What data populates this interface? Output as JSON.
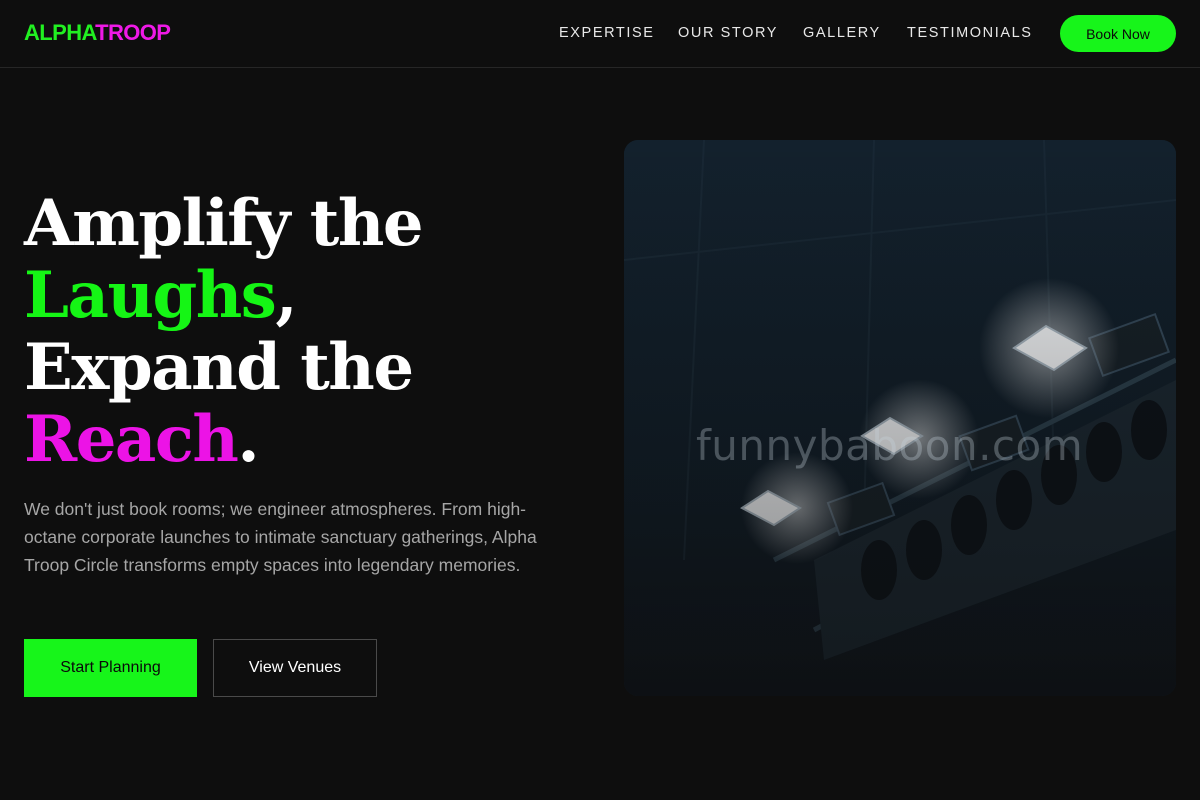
{
  "brand": {
    "part1": "ALPHA",
    "part2": "TROOP",
    "color1": "#21f021",
    "color2": "#ef19e7"
  },
  "nav": {
    "links": [
      "EXPERTISE",
      "OUR STORY",
      "GALLERY",
      "TESTIMONIALS"
    ],
    "cta": "Book Now"
  },
  "hero": {
    "title": {
      "line1": "Amplify the",
      "line2_word": "Laughs",
      "line2_punct": ",",
      "line3": "Expand the",
      "line4_word": "Reach",
      "line4_punct": "."
    },
    "description": "We don't just book rooms; we engineer atmospheres. From high-octane corporate launches to intimate sanctuary gatherings, Alpha Troop Circle transforms empty spaces into legendary memories.",
    "primary_button": "Start Planning",
    "secondary_button": "View Venues",
    "image_watermark": "funnybaboon.com"
  },
  "colors": {
    "accent_green": "#17f51a",
    "accent_magenta": "#ec13e6",
    "background": "#0e0e0e"
  }
}
